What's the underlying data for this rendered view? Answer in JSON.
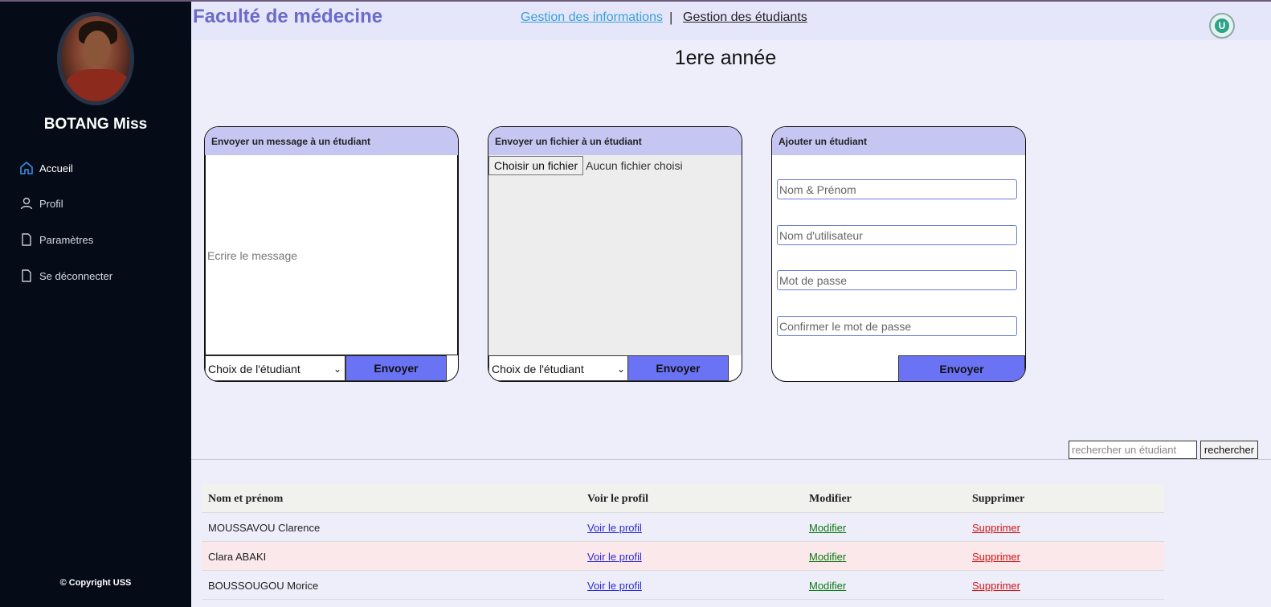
{
  "sidebar": {
    "username": "BOTANG Miss",
    "items": [
      {
        "label": "Accueil",
        "icon": "home-icon"
      },
      {
        "label": "Profil",
        "icon": "user-icon"
      },
      {
        "label": "Paramètres",
        "icon": "file-icon"
      },
      {
        "label": "Se déconnecter",
        "icon": "file-icon"
      }
    ],
    "copyright": "© Copyright USS"
  },
  "header": {
    "brand": "Faculté de médecine",
    "link_info": "Gestion des informations",
    "separator": "|",
    "link_students": "Gestion des étudiants",
    "logo_letter": "U"
  },
  "page_title": "1ere année",
  "cards": {
    "message": {
      "title": "Envoyer un message à un étudiant",
      "placeholder": "Ecrire le message",
      "select_label": "Choix de l'étudiant",
      "send_label": "Envoyer"
    },
    "file": {
      "title": "Envoyer un fichier à un étudiant",
      "choose_label": "Choisir un fichier",
      "no_file": "Aucun fichier choisi",
      "select_label": "Choix de l'étudiant",
      "send_label": "Envoyer"
    },
    "add": {
      "title": "Ajouter un étudiant",
      "fields": [
        "Nom & Prénom",
        "Nom d'utilisateur",
        "Mot de passe",
        "Confirmer le mot de passe"
      ],
      "send_label": "Envoyer"
    }
  },
  "search": {
    "placeholder": "rechercher un étudiant",
    "button": "rechercher"
  },
  "table": {
    "headers": [
      "Nom et prénom",
      "Voir le profil",
      "Modifier",
      "Supprimer"
    ],
    "rows": [
      {
        "name": "MOUSSAVOU Clarence",
        "view": "Voir le profil",
        "edit": "Modifier",
        "delete": "Supprimer"
      },
      {
        "name": "Clara ABAKI",
        "view": "Voir le profil",
        "edit": "Modifier",
        "delete": "Supprimer"
      },
      {
        "name": "BOUSSOUGOU Morice",
        "view": "Voir le profil",
        "edit": "Modifier",
        "delete": "Supprimer"
      }
    ]
  },
  "colors": {
    "sidebar_bg": "#050b17",
    "header_bg": "#e6e6fa",
    "card_head": "#c6c6f3",
    "button": "#6b73f5",
    "brand": "#6b6bc9"
  }
}
